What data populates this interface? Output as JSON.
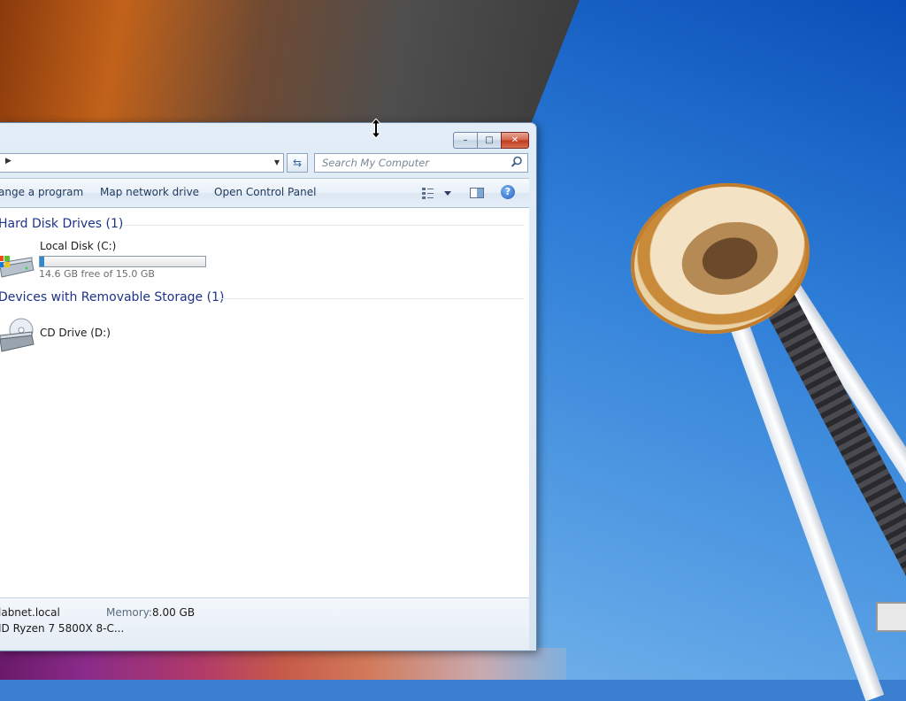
{
  "window": {
    "caption_buttons": {
      "minimize": "–",
      "maximize": "□",
      "close": "✕"
    }
  },
  "address": {
    "search_placeholder": "Search My Computer"
  },
  "commandbar": {
    "items": [
      {
        "label": "ange a program"
      },
      {
        "label": "Map network drive"
      },
      {
        "label": "Open Control Panel"
      }
    ],
    "help_label": "?"
  },
  "groups": [
    {
      "title": "Hard Disk Drives (1)",
      "drives": [
        {
          "name": "Local Disk (C:)",
          "free_text": "14.6 GB free of 15.0 GB",
          "used_fraction": 0.027
        }
      ]
    },
    {
      "title": "Devices with Removable Storage (1)",
      "drives": [
        {
          "name": "CD Drive (D:)"
        }
      ]
    }
  ],
  "details": {
    "domain": "labnet.local",
    "memory_label": "Memory:",
    "memory_value": "8.00 GB",
    "processor": "ID Ryzen 7 5800X 8-C..."
  },
  "colors": {
    "accent": "#1e3287",
    "capacity_fill": "#2f8ad1"
  },
  "icons": [
    "search-icon",
    "refresh-icon",
    "views-icon",
    "preview-pane-icon",
    "help-icon",
    "hard-drive-icon",
    "cd-drive-icon",
    "resize-cursor-icon"
  ]
}
